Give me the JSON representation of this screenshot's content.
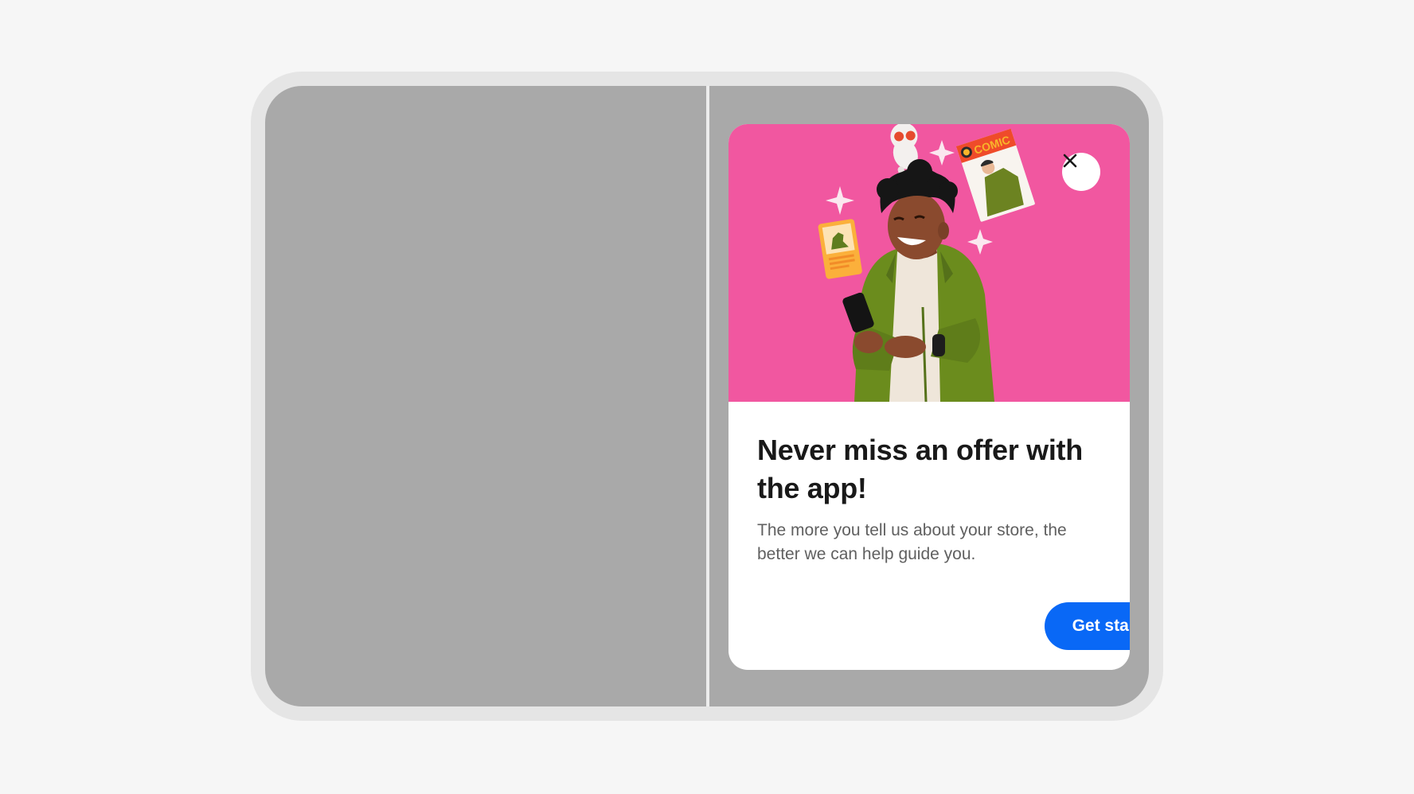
{
  "dialog": {
    "title": "Never miss an offer with the app!",
    "body": "The more you tell us about your store, the better we can help guide you.",
    "cta_label": "Get started",
    "close_icon": "close-icon"
  },
  "illustration": {
    "comic_label": "COMIC"
  },
  "colors": {
    "hero_background": "#f157a0",
    "primary_button": "#0968f6",
    "device_frame": "#e5e5e5",
    "screen_background": "#a9a9a9"
  }
}
